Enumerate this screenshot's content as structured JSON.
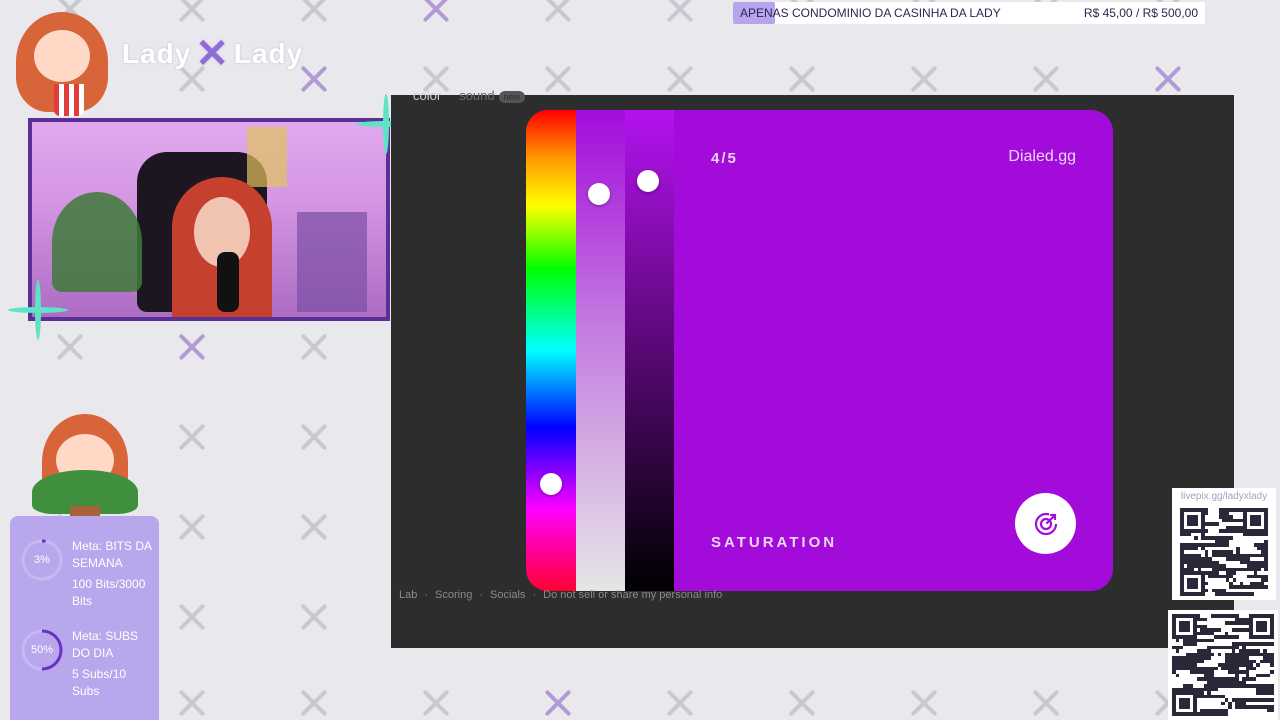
{
  "ticker": {
    "message": "APENAS CONDOMINIO DA CASINHA DA LADY",
    "amount": "R$ 45,00 / R$ 500,00",
    "progress": 0.09
  },
  "brand": {
    "left": "Lady",
    "right": "Lady"
  },
  "nav": {
    "tab_color": "color",
    "tab_sound": "sound",
    "badge": "new"
  },
  "game": {
    "step": "4/5",
    "site": "Dialed.gg",
    "parameter": "SATURATION",
    "color": "#a30bdb",
    "hue_level": 0.79,
    "saturation_level": 0.16,
    "brightness_level": 0.13
  },
  "footer": {
    "links": [
      "Lab",
      "Scoring",
      "Socials",
      "Do not sell or share my personal info"
    ],
    "separator": "·"
  },
  "goals": {
    "bits": {
      "percent_label": "3%",
      "progress": 0.03,
      "title": "Meta: BITS DA SEMANA",
      "detail": "100 Bits/3000 Bits"
    },
    "subs": {
      "percent_label": "50%",
      "progress": 0.5,
      "title": "Meta: SUBS DO DIA",
      "detail": "5 Subs/10 Subs"
    }
  },
  "qr": {
    "caption": "livepix.gg/ladyxlady"
  },
  "colors": {
    "accent": "#a30bdb",
    "overlay_purple": "#b8a7ec",
    "cam_border": "#5b2f93",
    "sparkle": "#5fe3c5"
  },
  "icons": [
    "submit-target-icon",
    "x-pattern-icon",
    "sparkle-icon",
    "qr-code-icon",
    "popcorn-icon",
    "plant-icon"
  ]
}
